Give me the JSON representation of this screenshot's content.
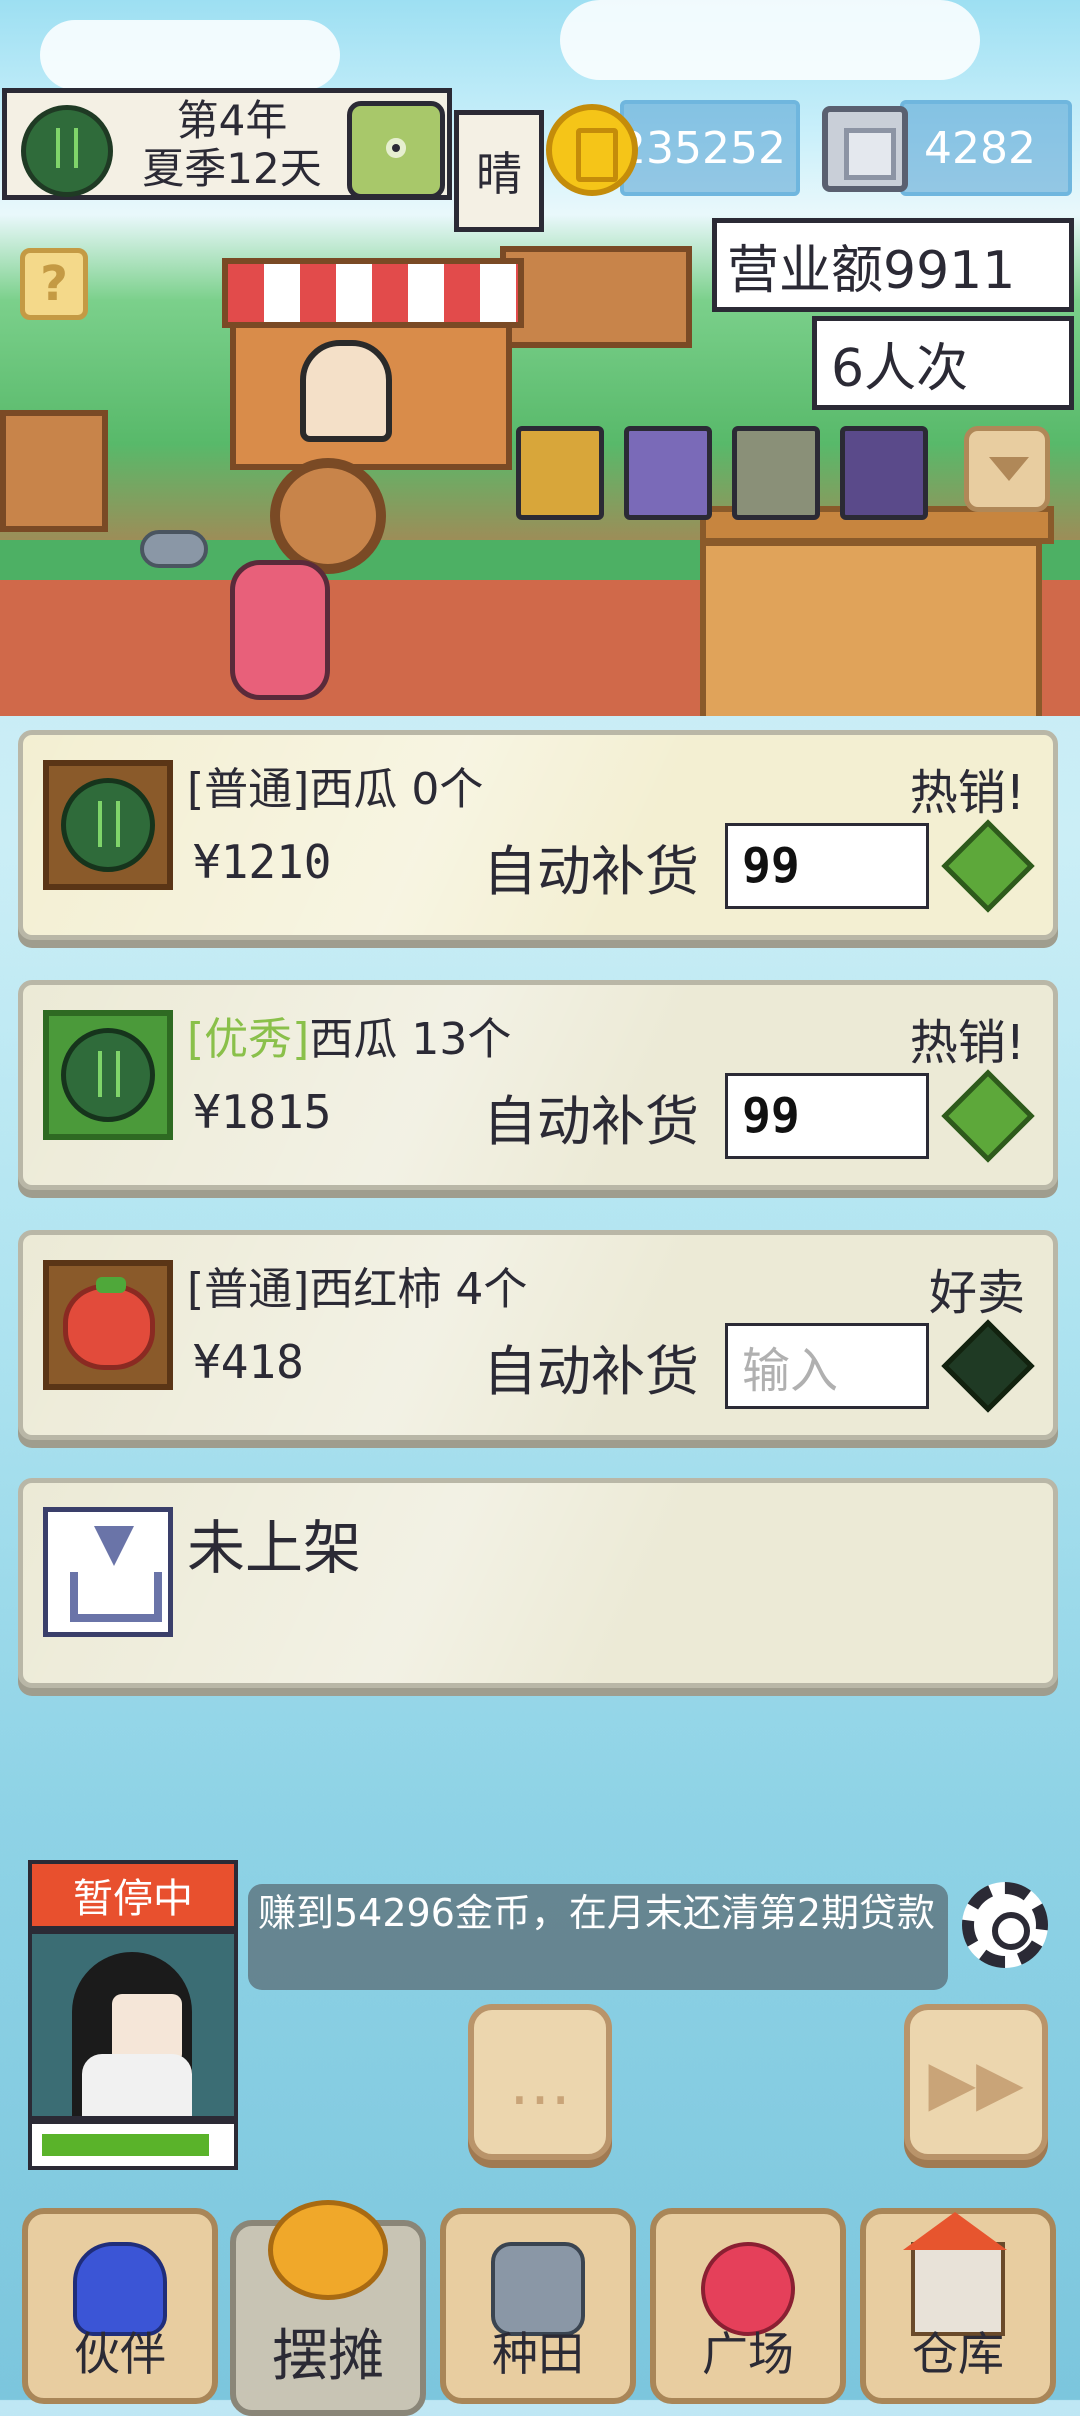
{
  "hud": {
    "date_line1": "第4年",
    "date_line2": "夏季12天",
    "weather": "晴",
    "coins": "235252",
    "gems": "4282",
    "help_symbol": "?"
  },
  "shop": {
    "sales_label": "营业额9911",
    "visitors_label": "6人次"
  },
  "products": [
    {
      "tag": "[普通]",
      "name": "西瓜",
      "count": "0个",
      "status": "热销!",
      "price": "¥1210",
      "restock_label": "自动补货",
      "restock_qty": "99",
      "highlight": true,
      "icon": "watermelon-icon"
    },
    {
      "tag": "[优秀]",
      "name": "西瓜",
      "count": "13个",
      "status": "热销!",
      "price": "¥1815",
      "restock_label": "自动补货",
      "restock_qty": "99",
      "highlight": false,
      "icon": "watermelon-icon"
    },
    {
      "tag": "[普通]",
      "name": "西红柿",
      "count": "4个",
      "status": "好卖",
      "price": "¥418",
      "restock_label": "自动补货",
      "restock_placeholder": "输入",
      "highlight": false,
      "icon": "tomato-icon"
    }
  ],
  "empty_slot": {
    "label": "未上架"
  },
  "status": {
    "paused_label": "暂停中",
    "quest_text": "赚到54296金币，在月末还清第2期贷款",
    "stamina_fraction": 0.92
  },
  "controls": {
    "chat_symbol": "…",
    "fast_forward_symbol": "▶▶"
  },
  "nav": {
    "tabs": [
      {
        "label": "伙伴",
        "icon": "partner-icon"
      },
      {
        "label": "摆摊",
        "icon": "stall-icon",
        "active": true
      },
      {
        "label": "种田",
        "icon": "watering-can-icon"
      },
      {
        "label": "广场",
        "icon": "flower-icon"
      },
      {
        "label": "仓库",
        "icon": "house-icon"
      }
    ]
  },
  "colors": {
    "accent_green": "#5da83a",
    "paused_red": "#e8502e",
    "quality_green": "#8ac04a"
  }
}
